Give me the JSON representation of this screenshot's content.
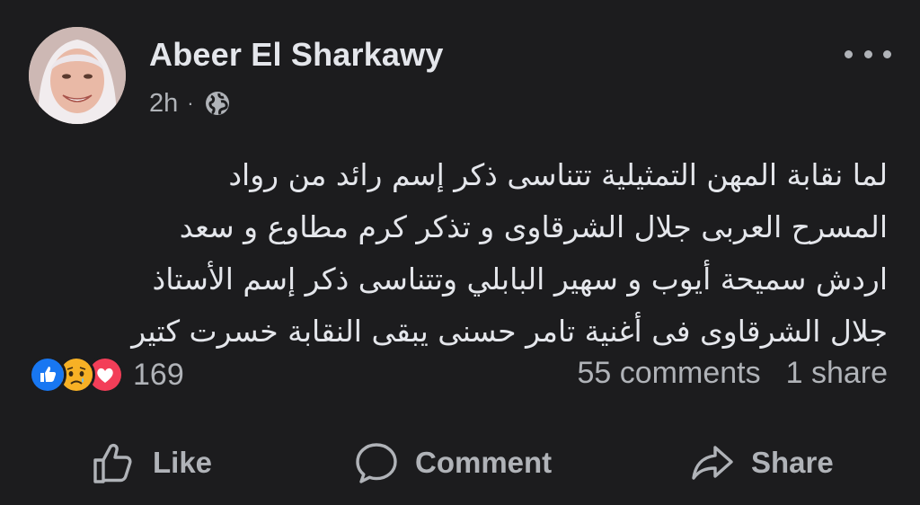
{
  "post": {
    "author": "Abeer El Sharkawy",
    "time": "2h",
    "separator": "·",
    "privacy_icon": "globe-icon",
    "text_lines": [
      "لما نقابة المهن التمثيلية تتناسى ذكر إسم رائد من رواد",
      "المسرح العربى جلال الشرقاوى و تذكر كرم مطاوع و سعد",
      "اردش سميحة أيوب و سهير البابلي وتتناسى ذكر إسم الأستاذ",
      "جلال الشرقاوى فى أغنية تامر حسنى يبقى النقابة خسرت كتير"
    ]
  },
  "reactions": {
    "icons": [
      "like-reaction-icon",
      "sad-reaction-icon",
      "love-reaction-icon"
    ],
    "count": "169",
    "comments": "55 comments",
    "shares": "1 share"
  },
  "actions": {
    "like": "Like",
    "comment": "Comment",
    "share": "Share"
  },
  "colors": {
    "background": "#1c1c1e",
    "text_primary": "#e4e6eb",
    "text_secondary": "#b0b3b8",
    "like_blue": "#1877f2",
    "love_red": "#f33e58",
    "sad_yellow": "#f7b125"
  }
}
